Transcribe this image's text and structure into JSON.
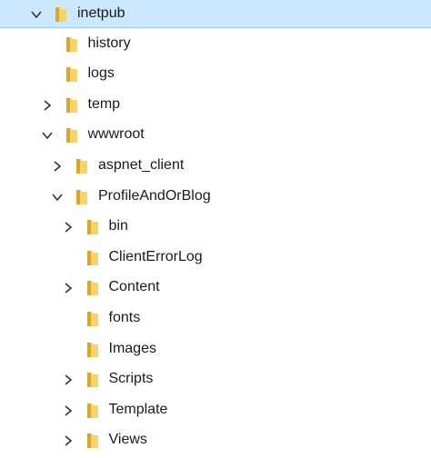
{
  "tree": {
    "items": [
      {
        "label": "inetpub",
        "state": "expanded",
        "level": 0,
        "selected": true
      },
      {
        "label": "history",
        "state": "leaf",
        "level": 1
      },
      {
        "label": "logs",
        "state": "leaf",
        "level": 1
      },
      {
        "label": "temp",
        "state": "collapsed",
        "level": 1
      },
      {
        "label": "wwwroot",
        "state": "expanded",
        "level": 1
      },
      {
        "label": "aspnet_client",
        "state": "collapsed",
        "level": 2
      },
      {
        "label": "ProfileAndOrBlog",
        "state": "expanded",
        "level": 2
      },
      {
        "label": "bin",
        "state": "collapsed",
        "level": 3
      },
      {
        "label": "ClientErrorLog",
        "state": "leaf",
        "level": 3
      },
      {
        "label": "Content",
        "state": "collapsed",
        "level": 3
      },
      {
        "label": "fonts",
        "state": "leaf",
        "level": 3
      },
      {
        "label": "Images",
        "state": "leaf",
        "level": 3
      },
      {
        "label": "Scripts",
        "state": "collapsed",
        "level": 3
      },
      {
        "label": "Template",
        "state": "collapsed",
        "level": 3
      },
      {
        "label": "Views",
        "state": "collapsed",
        "level": 3
      }
    ]
  },
  "colors": {
    "selection": "#cce8ff",
    "selection_border": "#99d1ff",
    "folder_body": "#f6d36b",
    "folder_dark": "#d9a72c",
    "chevron": "#333333"
  },
  "icons": {
    "folder": "folder-icon",
    "expanded": "chevron-down-icon",
    "collapsed": "chevron-right-icon"
  }
}
